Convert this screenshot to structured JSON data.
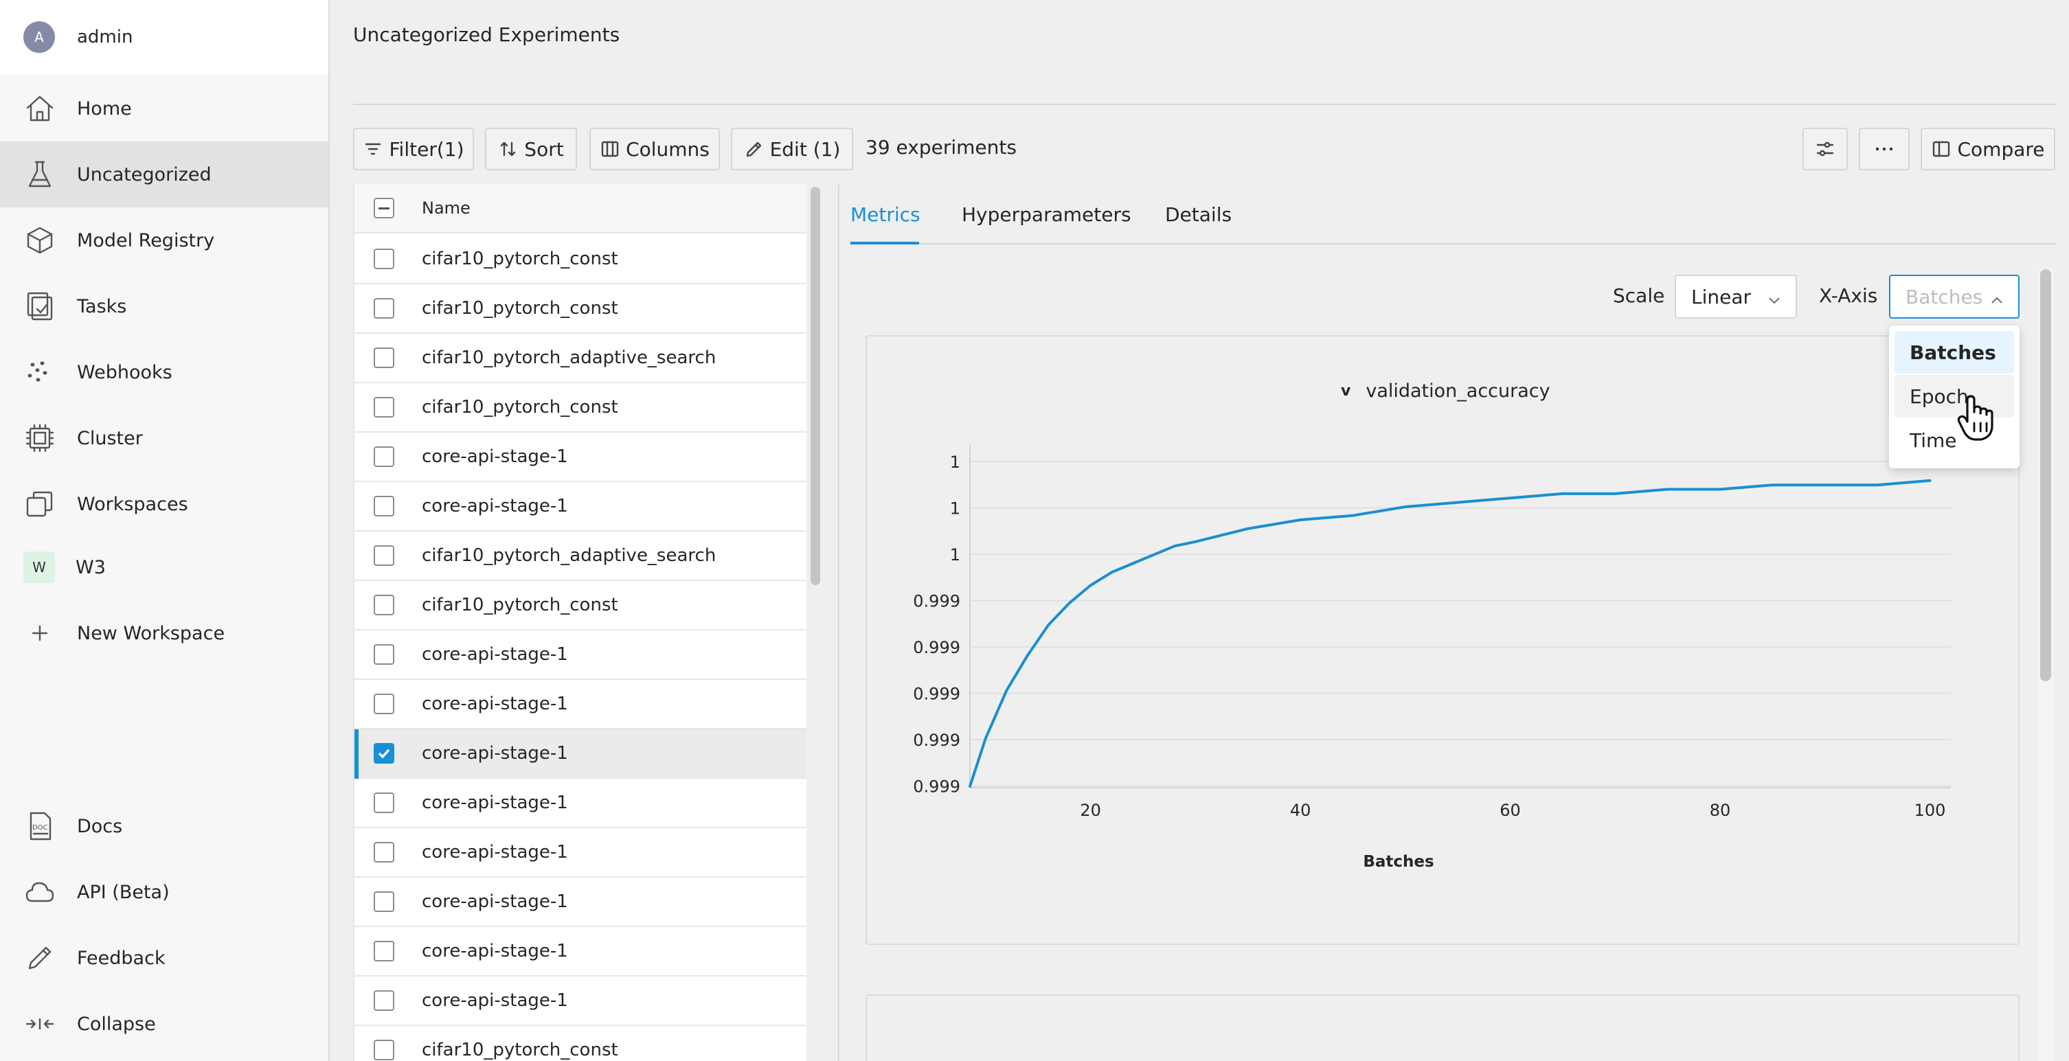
{
  "user": {
    "initial": "A",
    "name": "admin"
  },
  "sidebar": {
    "items": [
      {
        "label": "Home",
        "icon": "home-icon"
      },
      {
        "label": "Uncategorized",
        "icon": "flask-icon"
      },
      {
        "label": "Model Registry",
        "icon": "cube-icon"
      },
      {
        "label": "Tasks",
        "icon": "tasks-icon"
      },
      {
        "label": "Webhooks",
        "icon": "webhooks-icon"
      },
      {
        "label": "Cluster",
        "icon": "cluster-icon"
      },
      {
        "label": "Workspaces",
        "icon": "workspaces-icon"
      },
      {
        "label": "W3",
        "badge": "W"
      },
      {
        "label": "New Workspace",
        "icon": "plus-icon"
      }
    ],
    "bottom": [
      {
        "label": "Docs",
        "icon": "docs-icon"
      },
      {
        "label": "API (Beta)",
        "icon": "cloud-icon"
      },
      {
        "label": "Feedback",
        "icon": "pencil-icon"
      },
      {
        "label": "Collapse",
        "icon": "collapse-icon"
      }
    ]
  },
  "page": {
    "title": "Uncategorized Experiments"
  },
  "toolbar": {
    "filter": "Filter(1)",
    "sort": "Sort",
    "columns": "Columns",
    "edit": "Edit (1)",
    "count": "39 experiments",
    "compare": "Compare"
  },
  "table": {
    "header": "Name",
    "rows": [
      {
        "name": "cifar10_pytorch_const",
        "checked": false
      },
      {
        "name": "cifar10_pytorch_const",
        "checked": false
      },
      {
        "name": "cifar10_pytorch_adaptive_search",
        "checked": false
      },
      {
        "name": "cifar10_pytorch_const",
        "checked": false
      },
      {
        "name": "core-api-stage-1",
        "checked": false
      },
      {
        "name": "core-api-stage-1",
        "checked": false
      },
      {
        "name": "cifar10_pytorch_adaptive_search",
        "checked": false
      },
      {
        "name": "cifar10_pytorch_const",
        "checked": false
      },
      {
        "name": "core-api-stage-1",
        "checked": false
      },
      {
        "name": "core-api-stage-1",
        "checked": false
      },
      {
        "name": "core-api-stage-1",
        "checked": true
      },
      {
        "name": "core-api-stage-1",
        "checked": false
      },
      {
        "name": "core-api-stage-1",
        "checked": false
      },
      {
        "name": "core-api-stage-1",
        "checked": false
      },
      {
        "name": "core-api-stage-1",
        "checked": false
      },
      {
        "name": "core-api-stage-1",
        "checked": false
      },
      {
        "name": "cifar10_pytorch_const",
        "checked": false
      }
    ]
  },
  "tabs": {
    "metrics": "Metrics",
    "hyperparameters": "Hyperparameters",
    "details": "Details"
  },
  "controls": {
    "scale_label": "Scale",
    "scale_value": "Linear",
    "xaxis_label": "X-Axis",
    "xaxis_value": "Batches",
    "xaxis_options": [
      "Batches",
      "Epoch",
      "Time"
    ],
    "xaxis_selected": "Batches",
    "xaxis_hover": "Epoch"
  },
  "colors": {
    "accent": "#1890d5",
    "line": "#1a8fd1"
  },
  "chart_data": {
    "type": "line",
    "title": "validation_accuracy",
    "title_prefix": "v",
    "xlabel": "Batches",
    "ylabel": "",
    "x_ticks": [
      20,
      40,
      60,
      80,
      100
    ],
    "y_tick_labels": [
      "1",
      "1",
      "1",
      "0.999",
      "0.999",
      "0.999",
      "0.999",
      "0.999"
    ],
    "xlim": [
      8.5,
      102
    ],
    "ylim": [
      0.99925,
      1.0
    ],
    "grid": true,
    "series": [
      {
        "name": "validation_accuracy",
        "x": [
          8.5,
          10,
          12,
          14,
          16,
          18,
          20,
          22,
          25,
          28,
          30,
          35,
          40,
          45,
          50,
          55,
          60,
          65,
          70,
          75,
          80,
          85,
          90,
          95,
          100
        ],
        "y": [
          0.99925,
          0.99936,
          0.99947,
          0.99955,
          0.99962,
          0.99967,
          0.99971,
          0.99974,
          0.99977,
          0.9998,
          0.99981,
          0.99984,
          0.99986,
          0.99987,
          0.99989,
          0.9999,
          0.99991,
          0.99992,
          0.99992,
          0.99993,
          0.99993,
          0.99994,
          0.99994,
          0.99994,
          0.99995
        ]
      }
    ]
  }
}
